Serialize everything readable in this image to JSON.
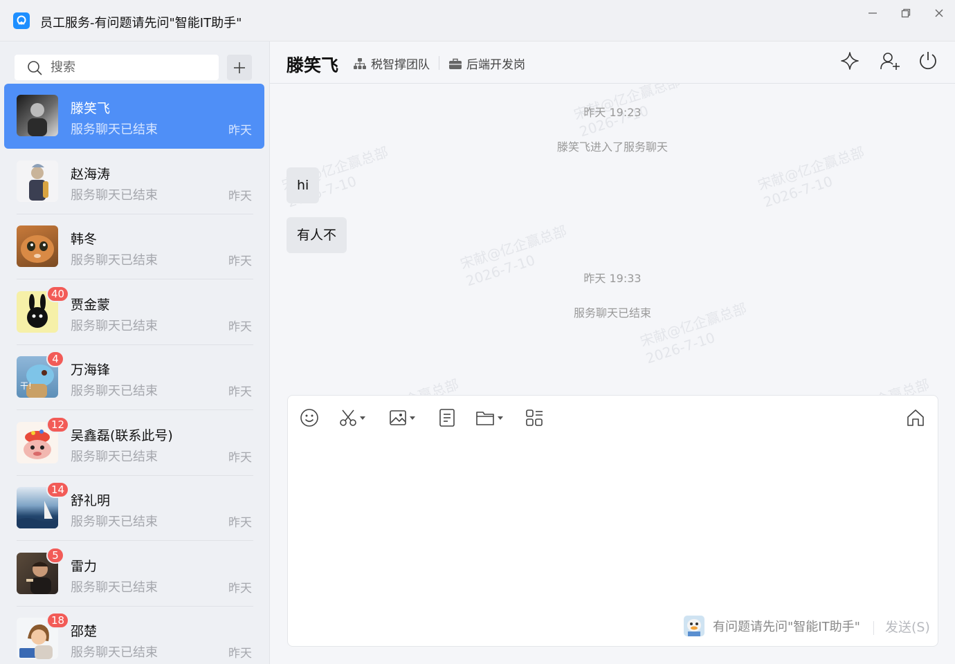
{
  "window": {
    "title": "员工服务-有问题请先问\"智能IT助手\""
  },
  "sidebar": {
    "search_placeholder": "搜索",
    "conversations": [
      {
        "name": "滕笑飞",
        "subtitle": "服务聊天已结束",
        "time": "昨天",
        "badge": "",
        "active": true
      },
      {
        "name": "赵海涛",
        "subtitle": "服务聊天已结束",
        "time": "昨天",
        "badge": ""
      },
      {
        "name": "韩冬",
        "subtitle": "服务聊天已结束",
        "time": "昨天",
        "badge": ""
      },
      {
        "name": "贾金蒙",
        "subtitle": "服务聊天已结束",
        "time": "昨天",
        "badge": "40"
      },
      {
        "name": "万海锋",
        "subtitle": "服务聊天已结束",
        "time": "昨天",
        "badge": "4"
      },
      {
        "name": "吴鑫磊(联系此号)",
        "subtitle": "服务聊天已结束",
        "time": "昨天",
        "badge": "12"
      },
      {
        "name": "舒礼明",
        "subtitle": "服务聊天已结束",
        "time": "昨天",
        "badge": "14"
      },
      {
        "name": "雷力",
        "subtitle": "服务聊天已结束",
        "time": "昨天",
        "badge": "5"
      },
      {
        "name": "邵楚",
        "subtitle": "服务聊天已结束",
        "time": "昨天",
        "badge": "18"
      }
    ]
  },
  "chat": {
    "peer_name": "滕笑飞",
    "team": "税智撑团队",
    "role": "后端开发岗",
    "watermark_name": "宋献@亿企赢总部",
    "watermark_date": "2026-7-10",
    "messages": [
      {
        "type": "time",
        "text": "昨天 19:23"
      },
      {
        "type": "system",
        "text": "滕笑飞进入了服务聊天"
      },
      {
        "type": "bubble",
        "text": "hi"
      },
      {
        "type": "bubble",
        "text": "有人不"
      },
      {
        "type": "time",
        "text": "昨天 19:33"
      },
      {
        "type": "system",
        "text": "服务聊天已结束"
      }
    ],
    "composer": {
      "assistant_hint": "有问题请先问\"智能IT助手\"",
      "send_label": "发送(S)"
    }
  },
  "colors": {
    "accent": "#4f8ff7",
    "badge": "#f25b57"
  }
}
